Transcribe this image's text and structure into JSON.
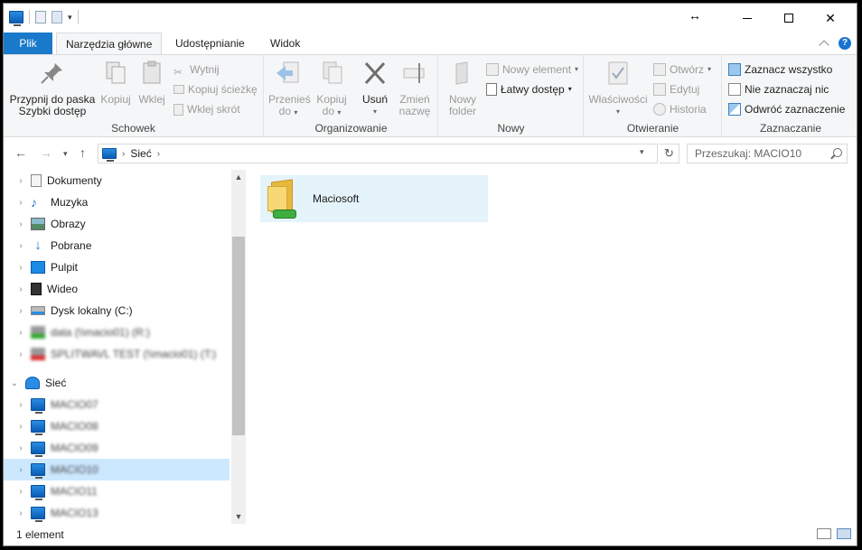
{
  "titlebar": {
    "qat_icons": [
      "computer-icon",
      "properties-icon",
      "new-folder-icon",
      "customize-dropdown-icon"
    ]
  },
  "tabs": [
    {
      "label": "Plik"
    },
    {
      "label": "Narzędzia główne"
    },
    {
      "label": "Udostępnianie"
    },
    {
      "label": "Widok"
    }
  ],
  "ribbon": {
    "clipboard": {
      "label": "Schowek",
      "pin_l1": "Przypnij do paska",
      "pin_l2": "Szybki dostęp",
      "copy": "Kopiuj",
      "paste": "Wklej",
      "cut": "Wytnij",
      "copy_path": "Kopiuj ścieżkę",
      "paste_shortcut": "Wklej skrót"
    },
    "organize": {
      "label": "Organizowanie",
      "move_l1": "Przenieś",
      "move_l2": "do",
      "copy_l1": "Kopiuj",
      "copy_l2": "do",
      "delete": "Usuń",
      "rename_l1": "Zmień",
      "rename_l2": "nazwę"
    },
    "new": {
      "label": "Nowy",
      "new_item": "Nowy element",
      "easy_access": "Łatwy dostęp",
      "folder_l1": "Nowy",
      "folder_l2": "folder"
    },
    "open": {
      "label": "Otwieranie",
      "properties": "Właściwości",
      "open": "Otwórz",
      "edit": "Edytuj",
      "history": "Historia"
    },
    "select": {
      "label": "Zaznaczanie",
      "select_all": "Zaznacz wszystko",
      "select_none": "Nie zaznaczaj nic",
      "invert": "Odwróć zaznaczenie"
    }
  },
  "address": {
    "path": [
      "Sieć"
    ],
    "search_placeholder": "Przeszukaj: MACIO10"
  },
  "nav": {
    "items": [
      {
        "label": "Dokumenty",
        "icon": "documents-icon"
      },
      {
        "label": "Muzyka",
        "icon": "music-icon"
      },
      {
        "label": "Obrazy",
        "icon": "pictures-icon"
      },
      {
        "label": "Pobrane",
        "icon": "downloads-icon"
      },
      {
        "label": "Pulpit",
        "icon": "desktop-icon"
      },
      {
        "label": "Wideo",
        "icon": "videos-icon"
      },
      {
        "label": "Dysk lokalny (C:)",
        "icon": "drive-icon"
      },
      {
        "label": "data (\\\\macio01) (R:)",
        "icon": "network-drive-icon"
      },
      {
        "label": "SPLITWAVL TEST (\\\\macio01) (T:)",
        "icon": "network-drive-icon"
      },
      {
        "label": "Sieć",
        "icon": "network-icon"
      },
      {
        "label": "MACIO07",
        "icon": "computer-icon"
      },
      {
        "label": "MACIO08",
        "icon": "computer-icon"
      },
      {
        "label": "MACIO09",
        "icon": "computer-icon"
      },
      {
        "label": "MACIO10",
        "icon": "computer-icon"
      },
      {
        "label": "MACIO11",
        "icon": "computer-icon"
      },
      {
        "label": "MACIO13",
        "icon": "computer-icon"
      }
    ]
  },
  "content": {
    "items": [
      {
        "name": "Maciosoft",
        "icon": "shared-folder-icon"
      }
    ]
  },
  "status": {
    "count": "1 element"
  }
}
